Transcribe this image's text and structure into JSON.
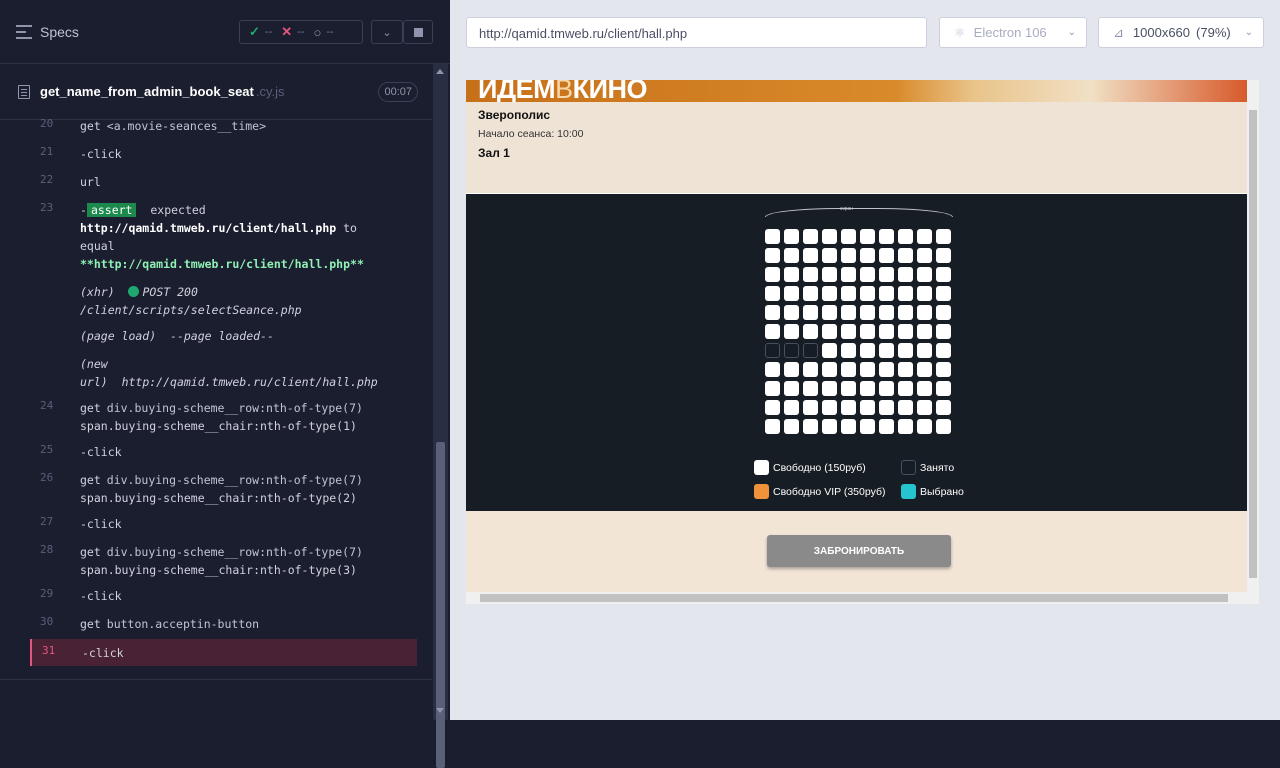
{
  "reporter": {
    "specs_label": "Specs",
    "stats": {
      "passed": "--",
      "failed": "--",
      "pending": "--"
    },
    "file": {
      "name": "get_name_from_admin_book_seat",
      "ext": ".cy.js",
      "duration": "00:07"
    },
    "commands": [
      {
        "num": "20",
        "name": "get",
        "msg": "<a.movie-seances__time>"
      },
      {
        "num": "21",
        "name": "-click",
        "msg": ""
      },
      {
        "num": "22",
        "name": "url",
        "msg": ""
      },
      {
        "num": "23",
        "prefix": "-",
        "badge": "assert",
        "expected": "expected",
        "line1": "http://qamid.tmweb.ru/client/hall.php",
        "to": "to",
        "line2": "equal",
        "line3": "**http://qamid.tmweb.ru/client/hall.php**"
      },
      {
        "xhr": "(xhr)",
        "xhr_text": "POST 200",
        "xhr_path": "/client/scripts/selectSeance.php"
      },
      {
        "pageload": "(page load)",
        "pageload_text": "--page loaded--"
      },
      {
        "newurl_1": "(new",
        "newurl_2": "url)",
        "newurl_text": "http://qamid.tmweb.ru/client/hall.php"
      },
      {
        "num": "24",
        "name": "get",
        "msg": "div.buying-scheme__row:nth-of-type(7)",
        "msg2": "span.buying-scheme__chair:nth-of-type(1)"
      },
      {
        "num": "25",
        "name": "-click",
        "msg": ""
      },
      {
        "num": "26",
        "name": "get",
        "msg": "div.buying-scheme__row:nth-of-type(7)",
        "msg2": "span.buying-scheme__chair:nth-of-type(2)"
      },
      {
        "num": "27",
        "name": "-click",
        "msg": ""
      },
      {
        "num": "28",
        "name": "get",
        "msg": "div.buying-scheme__row:nth-of-type(7)",
        "msg2": "span.buying-scheme__chair:nth-of-type(3)"
      },
      {
        "num": "29",
        "name": "-click",
        "msg": ""
      },
      {
        "num": "30",
        "name": "get",
        "msg": "button.acceptin-button"
      },
      {
        "num": "31",
        "name": "-click",
        "msg": ""
      }
    ]
  },
  "aut": {
    "url": "http://qamid.tmweb.ru/client/hall.php",
    "browser": "Electron 106",
    "viewport": "1000x660",
    "zoom": "(79%)"
  },
  "site": {
    "logo_a": "ИДЕМ",
    "logo_b": "В",
    "logo_c": "КИНО",
    "film": "Зверополис",
    "start": "Начало сеанса: 10:00",
    "hall": "Зал 1",
    "screen": "экран",
    "rows": 11,
    "cols": 10,
    "taken": [
      [
        6,
        0
      ],
      [
        6,
        1
      ],
      [
        6,
        2
      ]
    ],
    "legend": {
      "free": "Свободно (150руб)",
      "taken": "Занято",
      "vip": "Свободно VIP (350руб)",
      "selected": "Выбрано"
    },
    "colors": {
      "vip": "#f0923a",
      "selected": "#25c4ce",
      "free": "#ffffff"
    },
    "book_button": "ЗАБРОНИРОВАТЬ"
  }
}
